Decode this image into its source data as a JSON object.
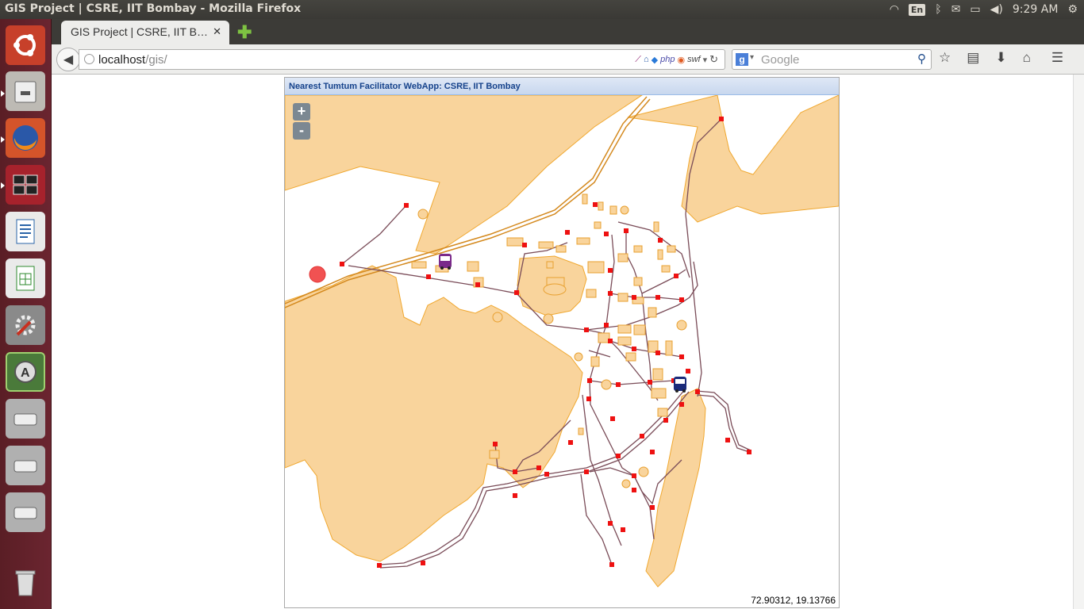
{
  "window": {
    "title": "GIS Project | CSRE, IIT Bombay - Mozilla Firefox"
  },
  "tray": {
    "lang": "En",
    "time": "9:29 AM"
  },
  "tab": {
    "label": "GIS Project | CSRE, IIT B…",
    "close": "✕"
  },
  "nav": {
    "url_host": "localhost",
    "url_path": "/gis/",
    "search_placeholder": "Google",
    "addons": [
      "php",
      "swf"
    ]
  },
  "map": {
    "header": "Nearest Tumtum Facilitator WebApp: CSRE, IIT Bombay",
    "zoom_in": "+",
    "zoom_out": "-",
    "coordinates": "72.90312, 19.13766"
  },
  "colors": {
    "land": "#f9d49c",
    "road": "#7a4c58",
    "stop": "#ee1111",
    "user": "#f04040",
    "launcher": "#5f2129"
  },
  "icons": [
    "ubuntu-icon",
    "files-icon",
    "firefox-icon",
    "workspace-icon",
    "writer-icon",
    "calc-icon",
    "settings-icon",
    "software-center-icon",
    "drive-icon",
    "drive-icon",
    "drive-icon",
    "trash-icon"
  ]
}
